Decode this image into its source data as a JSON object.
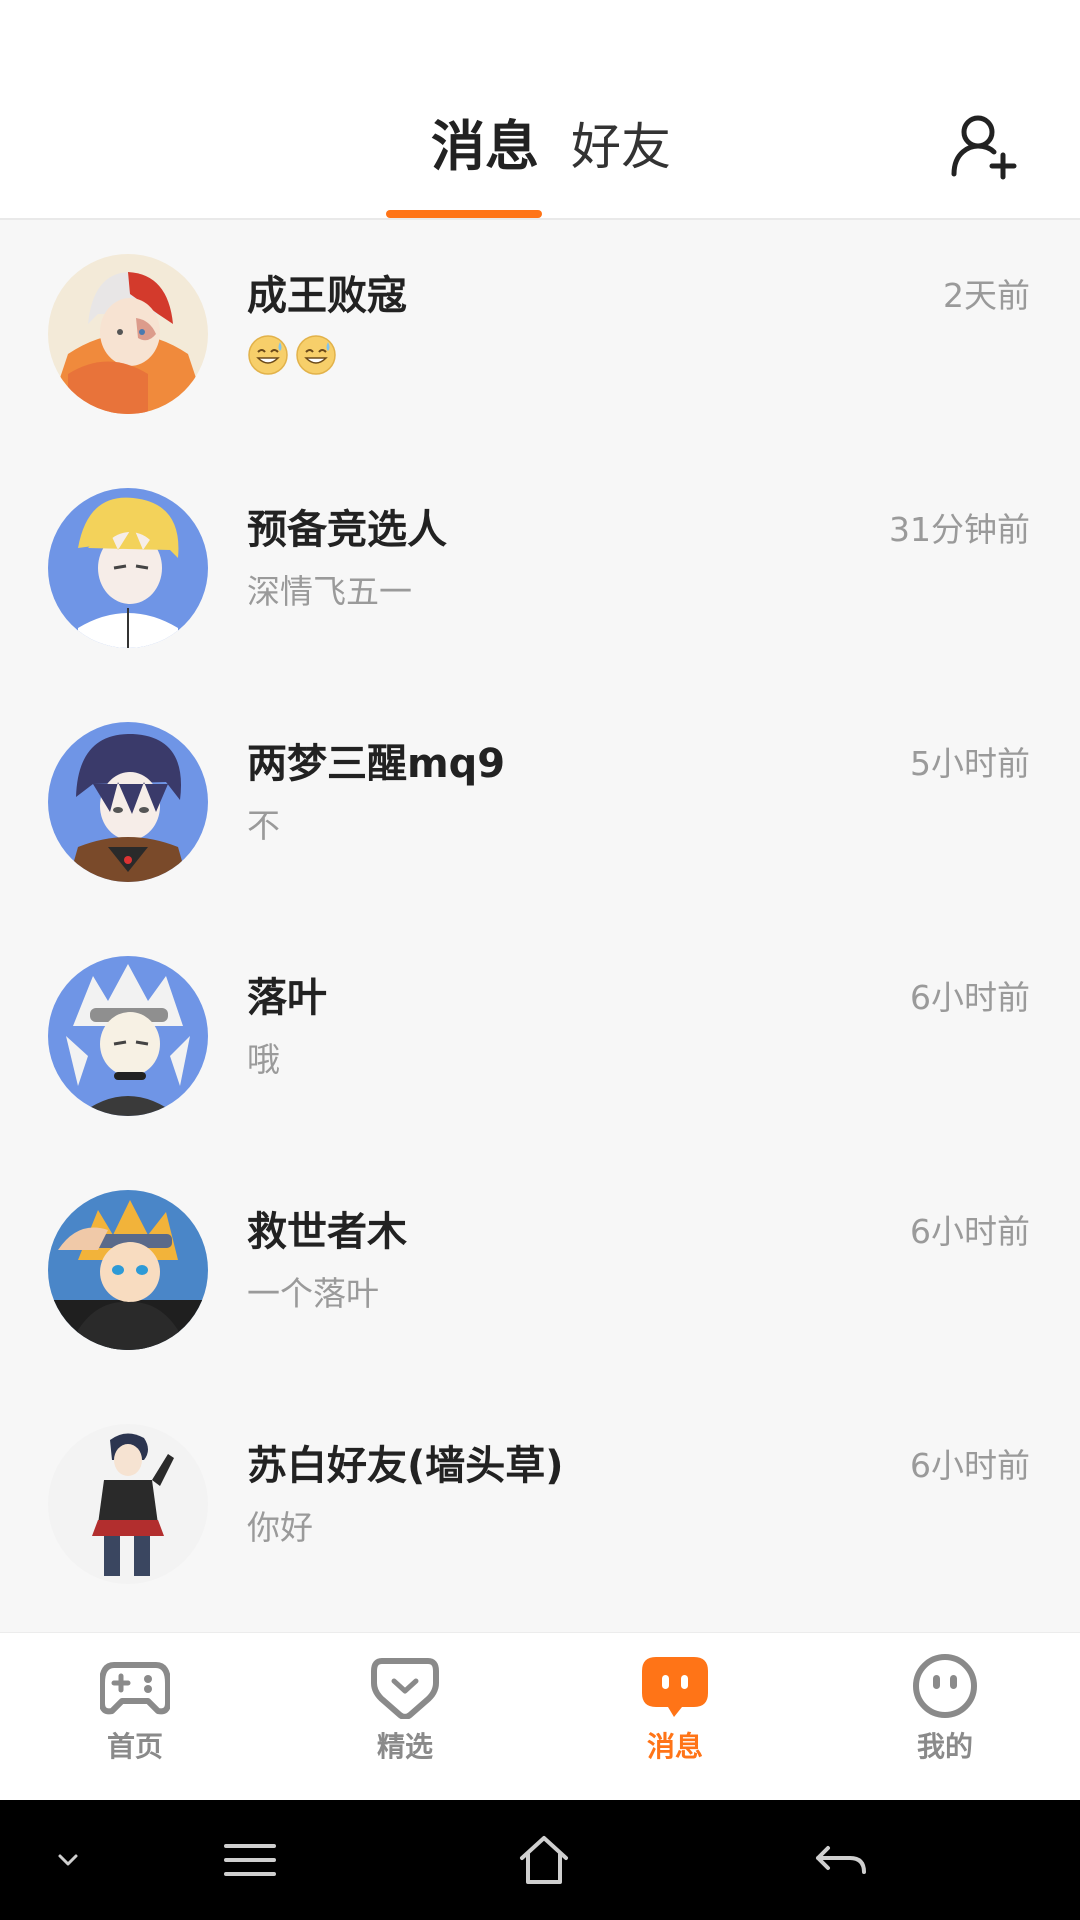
{
  "header": {
    "tabs": [
      {
        "label": "消息",
        "active": true
      },
      {
        "label": "好友",
        "active": false
      }
    ],
    "add_friend_icon": "add-user-icon"
  },
  "conversations": [
    {
      "name": "成王败寇",
      "preview": "",
      "preview_emoji": [
        "sweat-smile-emoji",
        "sweat-smile-emoji"
      ],
      "time": "2天前"
    },
    {
      "name": "预备竞选人",
      "preview": "深情飞五一",
      "time": "31分钟前"
    },
    {
      "name": "两梦三醒mq9",
      "preview": "不",
      "time": "5小时前"
    },
    {
      "name": "落叶",
      "preview": "哦",
      "time": "6小时前"
    },
    {
      "name": "救世者木",
      "preview": "一个落叶",
      "time": "6小时前"
    },
    {
      "name": "苏白好友(墙头草)",
      "preview": "你好",
      "time": "6小时前"
    }
  ],
  "bottom_nav": {
    "items": [
      {
        "label": "首页",
        "icon": "gamepad-icon",
        "active": false
      },
      {
        "label": "精选",
        "icon": "heart-badge-icon",
        "active": false
      },
      {
        "label": "消息",
        "icon": "chat-bubble-icon",
        "active": true
      },
      {
        "label": "我的",
        "icon": "face-icon",
        "active": false
      }
    ]
  },
  "colors": {
    "accent": "#ff7417",
    "text_primary": "#222222",
    "text_secondary": "#9a9a9a",
    "background": "#f7f7f7"
  }
}
